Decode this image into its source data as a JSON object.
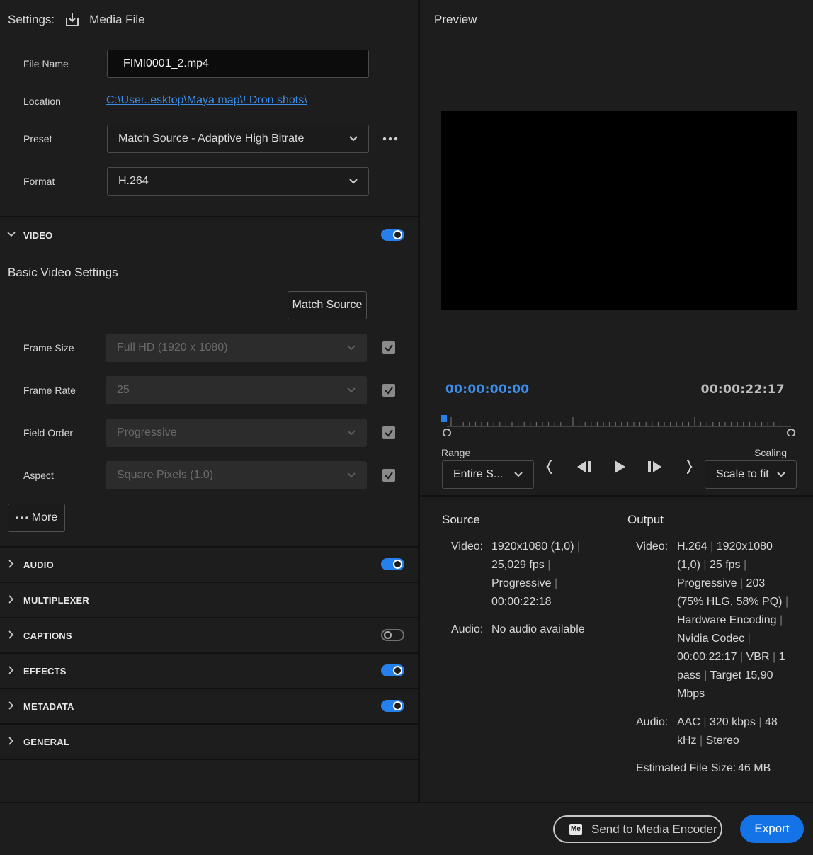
{
  "settings": {
    "label": "Settings:",
    "source_label": "Media File",
    "file_name_label": "File Name",
    "file_name_value": "FIMI0001_2.mp4",
    "location_label": "Location",
    "location_value": "C:\\User..esktop\\Maya map\\! Dron shots\\",
    "preset_label": "Preset",
    "preset_value": "Match Source - Adaptive High Bitrate",
    "format_label": "Format",
    "format_value": "H.264"
  },
  "video_section": {
    "title": "VIDEO",
    "enabled": true,
    "subheading": "Basic Video Settings",
    "match_source_label": "Match Source",
    "rows": [
      {
        "label": "Frame Size",
        "value": "Full HD (1920 x 1080)",
        "checked": true
      },
      {
        "label": "Frame Rate",
        "value": "25",
        "checked": true
      },
      {
        "label": "Field Order",
        "value": "Progressive",
        "checked": true
      },
      {
        "label": "Aspect",
        "value": "Square Pixels (1.0)",
        "checked": true
      }
    ],
    "more_label": "More"
  },
  "sections": [
    {
      "title": "AUDIO",
      "toggle": "on"
    },
    {
      "title": "MULTIPLEXER",
      "toggle": "none"
    },
    {
      "title": "CAPTIONS",
      "toggle": "off"
    },
    {
      "title": "EFFECTS",
      "toggle": "on"
    },
    {
      "title": "METADATA",
      "toggle": "on"
    },
    {
      "title": "GENERAL",
      "toggle": "none"
    }
  ],
  "preview": {
    "title": "Preview",
    "timecode_start": "00:00:00:00",
    "timecode_end": "00:00:22:17",
    "range_label": "Range",
    "range_value": "Entire S...",
    "scaling_label": "Scaling",
    "scaling_value": "Scale to fit"
  },
  "source": {
    "title": "Source",
    "video_label": "Video:",
    "video_lines": [
      "1920x1080 (1,0)",
      "25,029 fps",
      "Progressive",
      "00:00:22:18"
    ],
    "audio_label": "Audio:",
    "audio_value": "No audio available"
  },
  "output": {
    "title": "Output",
    "video_label": "Video:",
    "video_l1a": "H.264",
    "video_l1b": "1920x1080",
    "video_l2a": "(1,0)",
    "video_l2b": "25 fps",
    "video_l3a": "Progressive",
    "video_l3b": "203",
    "video_l4": "(75% HLG, 58% PQ)",
    "video_l5": "Hardware Encoding",
    "video_l6": "Nvidia Codec",
    "video_l7a": "00:00:22:17",
    "video_l7b": "VBR",
    "video_l7c": "1",
    "video_l8a": "pass",
    "video_l8b": "Target 15,90",
    "video_l9": "Mbps",
    "audio_label": "Audio:",
    "audio_l1a": "AAC",
    "audio_l1b": "320 kbps",
    "audio_l1c": "48",
    "audio_l2a": "kHz",
    "audio_l2b": "Stereo",
    "size_label": "Estimated File Size:",
    "size_value": "46 MB"
  },
  "footer": {
    "ame_badge": "Me",
    "send_label": "Send to Media Encoder",
    "export_label": "Export"
  },
  "colors": {
    "accent": "#2680eb",
    "export": "#1473e6",
    "link": "#3b8de8"
  }
}
